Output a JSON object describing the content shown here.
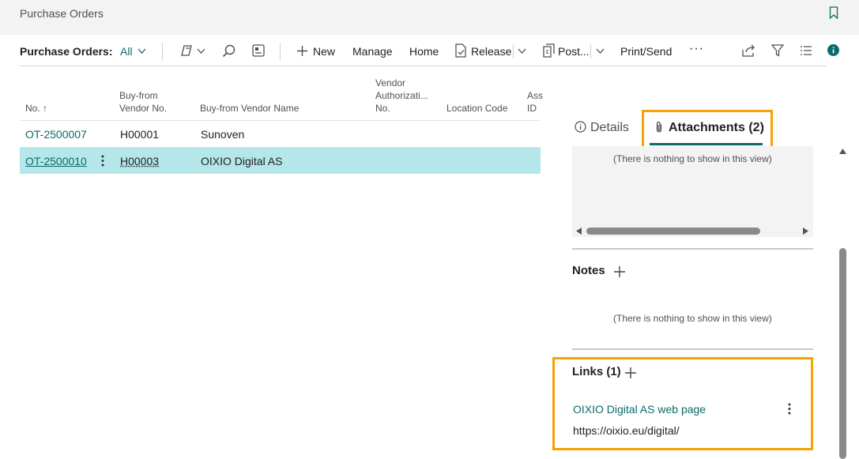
{
  "page": {
    "title": "Purchase Orders"
  },
  "toolbar": {
    "label": "Purchase Orders:",
    "filter": "All",
    "new": "New",
    "manage": "Manage",
    "home": "Home",
    "release": "Release",
    "post": "Post...",
    "print_send": "Print/Send",
    "more": "···"
  },
  "columns": {
    "no": "No. ↑",
    "vendor_no_1": "Buy-from",
    "vendor_no_2": "Vendor No.",
    "vendor_name": "Buy-from Vendor Name",
    "auth_1": "Vendor",
    "auth_2": "Authorizati...",
    "auth_3": "No.",
    "location": "Location Code",
    "assigned_1": "Ass",
    "assigned_2": "ID"
  },
  "rows": [
    {
      "no": "OT-2500007",
      "vendor_no": "H00001",
      "vendor_name": "Sunoven"
    },
    {
      "no": "OT-2500010",
      "vendor_no": "H00003",
      "vendor_name": "OIXIO Digital AS"
    }
  ],
  "factbox": {
    "tab_details": "Details",
    "tab_attachments": "Attachments (2)",
    "empty_text": "(There is nothing to show in this view)",
    "notes_title": "Notes",
    "notes_empty": "(There is nothing to show in this view)",
    "links_title": "Links (1)",
    "link_name": "OIXIO Digital AS web page",
    "link_url": "https://oixio.eu/digital/"
  },
  "colors": {
    "accent": "#0b6a6a",
    "highlight": "#f5a300",
    "selected_row": "#b4e6ea"
  }
}
